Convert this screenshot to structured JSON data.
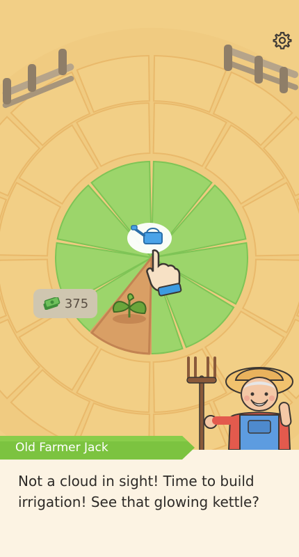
{
  "hud": {
    "money": "375",
    "money_icon": "cash-icon",
    "settings_icon": "gear-icon"
  },
  "farm": {
    "field_colors": {
      "sand": "#f2cf86",
      "sand_dark": "#e9b96b",
      "grass": "#9cd56b",
      "grass_edge": "#7ec456",
      "soil": "#d99f65",
      "soil_dark": "#c28352"
    },
    "pointer": {
      "icon": "watering-can-icon",
      "hand_icon": "tap-hand-icon"
    }
  },
  "dialog": {
    "speaker": "Old Farmer Jack",
    "message": "Not a cloud in sight! Time to build irrigation! See that glowing kettle?",
    "banner_color": "#7cc340",
    "panel_color": "#fcf3e3"
  }
}
